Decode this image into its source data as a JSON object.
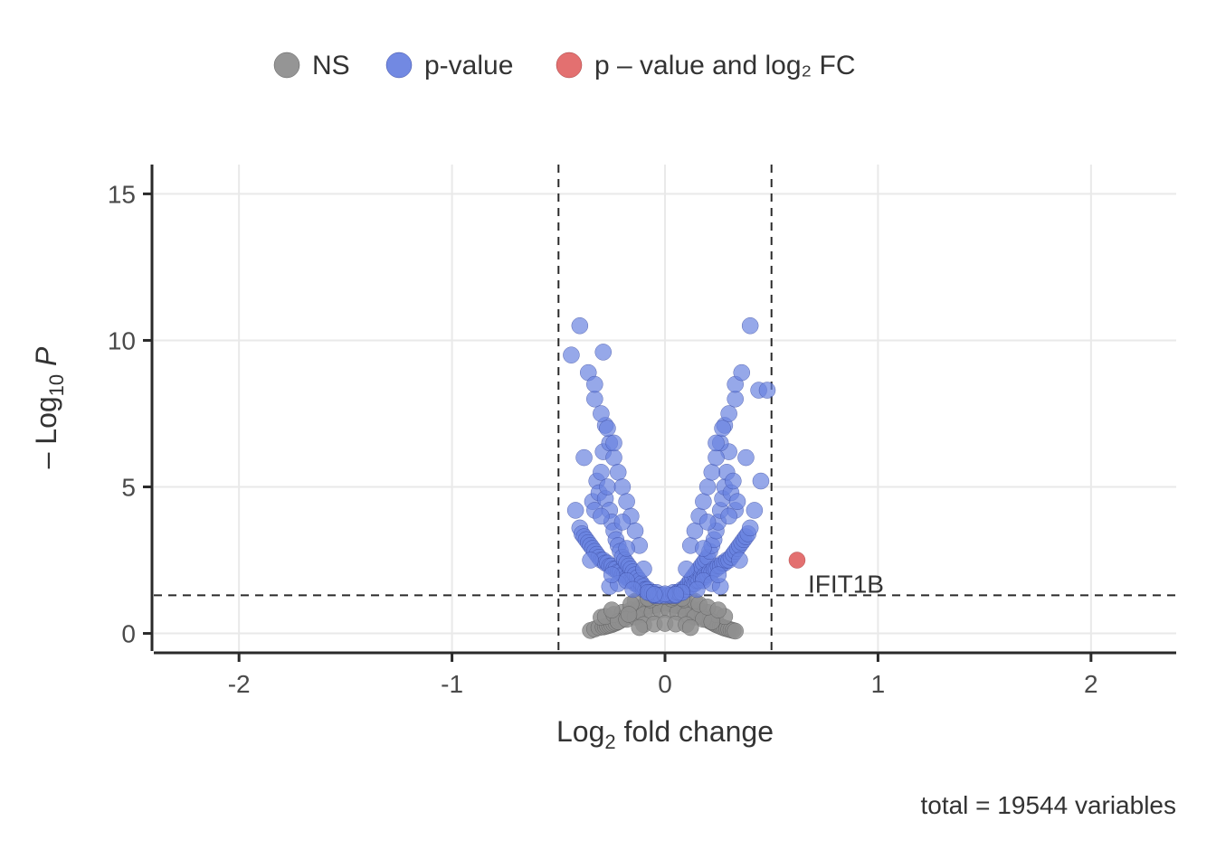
{
  "chart_data": {
    "type": "scatter",
    "title": "",
    "xlabel": "Log₂ fold change",
    "ylabel": "– Log₁₀ P",
    "ylabel_plain": "-Log10 P",
    "xlabel_plain": "Log2 fold change",
    "xlim": [
      -2.4,
      2.4
    ],
    "ylim": [
      -0.6,
      16
    ],
    "x_ticks": [
      -2,
      -1,
      0,
      1,
      2
    ],
    "y_ticks": [
      0,
      5,
      10,
      15
    ],
    "grid": true,
    "thresholds": {
      "x_neg": -0.5,
      "x_pos": 0.5,
      "y": 1.3
    },
    "legend": [
      {
        "label": "NS",
        "color": "#8f8f8f"
      },
      {
        "label": "p-value",
        "color": "#6a83e0"
      },
      {
        "label": "p – value and log₂ FC",
        "color": "#e26868"
      }
    ],
    "annotations": [
      {
        "x": 0.62,
        "y": 2.5,
        "label": "IFIT1B",
        "color": "#e26868"
      }
    ],
    "caption": "total = 19544 variables",
    "series": [
      {
        "name": "NS",
        "color": "#8f8f8f",
        "x": [
          -0.35,
          -0.33,
          -0.31,
          -0.29,
          -0.28,
          -0.27,
          -0.26,
          -0.25,
          -0.24,
          -0.23,
          -0.22,
          -0.21,
          -0.2,
          -0.19,
          -0.18,
          -0.17,
          -0.16,
          -0.15,
          -0.14,
          -0.13,
          -0.12,
          -0.11,
          -0.1,
          -0.09,
          -0.08,
          -0.07,
          -0.06,
          -0.05,
          -0.04,
          -0.03,
          -0.02,
          -0.01,
          0.0,
          0.01,
          0.02,
          0.03,
          0.04,
          0.05,
          0.06,
          0.07,
          0.08,
          0.09,
          0.1,
          0.11,
          0.12,
          0.13,
          0.14,
          0.15,
          0.16,
          0.17,
          0.18,
          0.19,
          0.2,
          0.21,
          0.22,
          0.23,
          0.24,
          0.25,
          0.26,
          0.27,
          0.28,
          0.29,
          0.3,
          0.31,
          0.32,
          0.33,
          -0.3,
          -0.28,
          -0.24,
          -0.2,
          -0.16,
          -0.12,
          -0.08,
          -0.04,
          0.0,
          0.04,
          0.08,
          0.12,
          0.16,
          0.2,
          0.24,
          0.28,
          -0.22,
          -0.18,
          -0.14,
          -0.1,
          -0.06,
          -0.02,
          0.02,
          0.06,
          0.1,
          0.14,
          0.18,
          0.22,
          -0.1,
          -0.05,
          0.0,
          0.05,
          0.1,
          -0.14,
          -0.07,
          0.03,
          0.09,
          0.14,
          -0.12,
          0.12,
          -0.08,
          0.08,
          -0.04,
          0.04,
          0.0,
          -0.16,
          0.16,
          0.2,
          -0.25,
          0.25,
          -0.17
        ],
        "y": [
          0.1,
          0.15,
          0.2,
          0.22,
          0.24,
          0.26,
          0.28,
          0.3,
          0.33,
          0.36,
          0.4,
          0.44,
          0.48,
          0.52,
          0.56,
          0.6,
          0.64,
          0.68,
          0.72,
          0.76,
          0.8,
          0.82,
          0.85,
          0.88,
          0.9,
          0.92,
          0.94,
          0.96,
          0.98,
          1.0,
          1.02,
          1.04,
          1.06,
          1.04,
          1.02,
          1.0,
          0.98,
          0.96,
          0.94,
          0.92,
          0.9,
          0.88,
          0.85,
          0.82,
          0.78,
          0.74,
          0.7,
          0.66,
          0.62,
          0.58,
          0.54,
          0.5,
          0.46,
          0.42,
          0.38,
          0.34,
          0.3,
          0.27,
          0.24,
          0.21,
          0.18,
          0.16,
          0.14,
          0.12,
          0.1,
          0.08,
          0.55,
          0.58,
          0.65,
          0.72,
          0.8,
          0.88,
          0.95,
          1.0,
          1.05,
          1.0,
          0.95,
          0.88,
          0.8,
          0.72,
          0.65,
          0.58,
          0.4,
          0.48,
          0.56,
          0.64,
          0.72,
          0.8,
          0.8,
          0.72,
          0.64,
          0.56,
          0.48,
          0.4,
          0.3,
          0.32,
          0.34,
          0.32,
          0.3,
          1.1,
          1.15,
          1.18,
          1.15,
          1.1,
          0.2,
          0.2,
          1.2,
          1.2,
          1.24,
          1.24,
          1.26,
          1.0,
          1.0,
          0.9,
          0.8,
          0.8,
          0.65
        ]
      },
      {
        "name": "p-value",
        "color": "#6a83e0",
        "x": [
          -0.44,
          -0.42,
          -0.4,
          -0.39,
          -0.38,
          -0.37,
          -0.36,
          -0.35,
          -0.34,
          -0.34,
          -0.33,
          -0.33,
          -0.32,
          -0.32,
          -0.31,
          -0.31,
          -0.3,
          -0.3,
          -0.29,
          -0.29,
          -0.28,
          -0.28,
          -0.27,
          -0.27,
          -0.26,
          -0.26,
          -0.25,
          -0.25,
          -0.24,
          -0.24,
          -0.23,
          -0.23,
          -0.22,
          -0.22,
          -0.21,
          -0.21,
          -0.2,
          -0.2,
          -0.19,
          -0.19,
          -0.18,
          -0.18,
          -0.17,
          -0.17,
          -0.16,
          -0.16,
          -0.15,
          -0.15,
          -0.14,
          -0.14,
          -0.13,
          -0.13,
          -0.12,
          -0.12,
          -0.11,
          -0.11,
          -0.1,
          -0.1,
          -0.09,
          -0.09,
          -0.08,
          -0.08,
          -0.07,
          -0.07,
          -0.06,
          -0.06,
          -0.05,
          -0.05,
          -0.04,
          -0.04,
          -0.03,
          -0.02,
          0.0,
          0.02,
          0.03,
          0.04,
          0.04,
          0.05,
          0.05,
          0.06,
          0.06,
          0.07,
          0.07,
          0.08,
          0.08,
          0.09,
          0.09,
          0.1,
          0.1,
          0.11,
          0.11,
          0.12,
          0.12,
          0.13,
          0.13,
          0.14,
          0.14,
          0.15,
          0.15,
          0.16,
          0.16,
          0.17,
          0.17,
          0.18,
          0.18,
          0.19,
          0.19,
          0.2,
          0.2,
          0.21,
          0.21,
          0.22,
          0.22,
          0.23,
          0.23,
          0.24,
          0.24,
          0.25,
          0.25,
          0.26,
          0.26,
          0.27,
          0.27,
          0.28,
          0.28,
          0.29,
          0.29,
          0.3,
          0.3,
          0.31,
          0.31,
          0.32,
          0.32,
          0.33,
          0.33,
          0.34,
          0.34,
          0.35,
          0.36,
          0.37,
          0.38,
          0.39,
          0.4,
          0.42,
          0.44,
          -0.28,
          -0.26,
          -0.24,
          -0.22,
          -0.2,
          -0.18,
          -0.16,
          -0.14,
          -0.12,
          0.12,
          0.14,
          0.16,
          0.18,
          0.2,
          0.22,
          0.24,
          0.26,
          0.28,
          -0.33,
          -0.3,
          -0.27,
          -0.24,
          0.24,
          0.27,
          0.3,
          0.33,
          -0.36,
          -0.33,
          0.33,
          0.36,
          -0.4,
          0.4,
          0.48,
          0.45,
          -0.26,
          -0.22,
          -0.18,
          0.18,
          0.22,
          0.26,
          -0.2,
          0.2,
          -0.29,
          -0.3,
          0.3,
          -0.25,
          0.25,
          -0.35,
          0.35,
          -0.38,
          0.38,
          -0.18,
          -0.1,
          0.1,
          0.18,
          -0.15,
          0.15,
          -0.08,
          0.08,
          0.0,
          -0.05,
          0.05
        ],
        "y": [
          9.5,
          4.2,
          3.6,
          3.4,
          3.3,
          3.2,
          3.1,
          3.0,
          2.9,
          4.5,
          2.8,
          4.2,
          2.7,
          5.2,
          2.6,
          4.8,
          2.5,
          5.5,
          2.5,
          6.2,
          2.4,
          4.6,
          2.4,
          5.0,
          2.3,
          4.2,
          2.3,
          3.8,
          2.2,
          3.5,
          2.2,
          3.2,
          2.1,
          3.0,
          2.1,
          2.8,
          2.0,
          2.6,
          2.0,
          2.5,
          1.9,
          2.4,
          1.9,
          2.3,
          1.8,
          2.2,
          1.8,
          2.1,
          1.7,
          2.0,
          1.7,
          1.9,
          1.6,
          1.8,
          1.6,
          1.7,
          1.5,
          1.6,
          1.5,
          1.5,
          1.4,
          1.5,
          1.4,
          1.4,
          1.4,
          1.4,
          1.3,
          1.3,
          1.3,
          1.4,
          1.3,
          1.3,
          1.3,
          1.3,
          1.3,
          1.3,
          1.4,
          1.3,
          1.3,
          1.4,
          1.4,
          1.4,
          1.4,
          1.4,
          1.5,
          1.5,
          1.5,
          1.5,
          1.6,
          1.6,
          1.7,
          1.6,
          1.8,
          1.7,
          1.9,
          1.7,
          2.0,
          1.8,
          2.1,
          1.8,
          2.2,
          1.9,
          2.3,
          1.9,
          2.4,
          2.0,
          2.5,
          2.0,
          2.6,
          2.1,
          2.8,
          2.1,
          3.0,
          2.2,
          3.2,
          2.2,
          3.5,
          2.3,
          3.8,
          2.3,
          4.2,
          2.4,
          4.6,
          2.4,
          5.0,
          2.5,
          5.5,
          2.5,
          6.2,
          2.6,
          4.8,
          2.7,
          5.2,
          2.8,
          4.2,
          2.9,
          4.5,
          3.0,
          3.1,
          3.2,
          3.3,
          3.4,
          3.6,
          4.2,
          8.3,
          7.1,
          6.5,
          6.0,
          5.5,
          5.0,
          4.5,
          4.0,
          3.5,
          3.0,
          3.0,
          3.5,
          4.0,
          4.5,
          5.0,
          5.5,
          6.0,
          6.5,
          7.1,
          8.0,
          7.5,
          7.0,
          6.5,
          6.5,
          7.0,
          7.5,
          8.0,
          8.9,
          8.5,
          8.5,
          8.9,
          10.5,
          10.5,
          8.3,
          5.2,
          1.6,
          1.7,
          1.8,
          1.8,
          1.7,
          1.6,
          3.8,
          3.8,
          9.6,
          4.0,
          4.0,
          2.0,
          2.0,
          2.5,
          2.5,
          6.0,
          6.0,
          2.9,
          2.2,
          2.2,
          2.9,
          1.5,
          1.5,
          1.4,
          1.4,
          1.35,
          1.33,
          1.33
        ]
      },
      {
        "name": "p-value and log2 FC",
        "color": "#e26868",
        "x": [
          0.62
        ],
        "y": [
          2.5
        ]
      }
    ],
    "x_tick_labels": [
      "-2",
      "-1",
      "0",
      "1",
      "2"
    ],
    "y_tick_labels": [
      "0",
      "5",
      "10",
      "15"
    ]
  }
}
